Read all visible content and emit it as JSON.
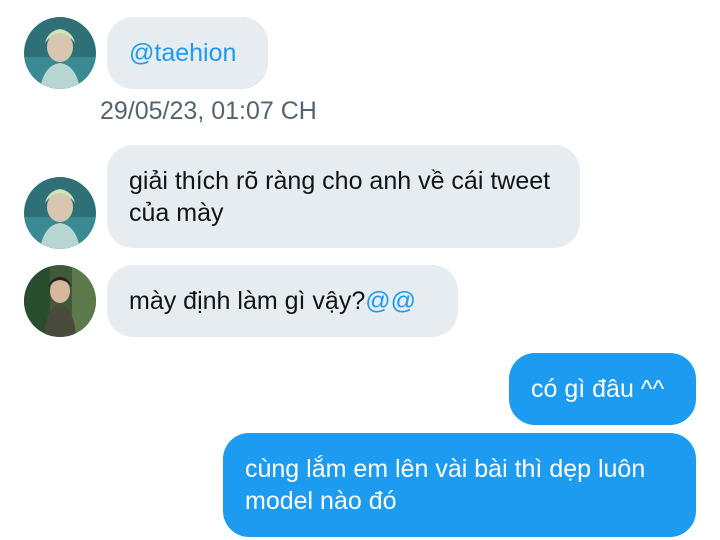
{
  "conversation": {
    "messages": [
      {
        "sender": "other",
        "mention": "@taehion"
      },
      {
        "sender": "other",
        "text": "giải thích rõ ràng cho anh về cái tweet của mày"
      },
      {
        "sender": "other2",
        "text": "mày định làm gì vậy?",
        "mention": "@@"
      },
      {
        "sender": "me",
        "text": "có gì đâu ^^"
      },
      {
        "sender": "me",
        "text": "cùng lắm em lên vài bài thì dẹp luôn model nào đó"
      }
    ],
    "timestamp": "29/05/23, 01:07 CH"
  },
  "colors": {
    "incoming_bubble": "#e6ecf0",
    "outgoing_bubble": "#1d9bf0",
    "mention": "#1d9bf0",
    "timestamp": "#536471"
  },
  "icons": {
    "avatar_1": "avatar-blond-man-teal-background",
    "avatar_2": "avatar-person-forest-background"
  }
}
